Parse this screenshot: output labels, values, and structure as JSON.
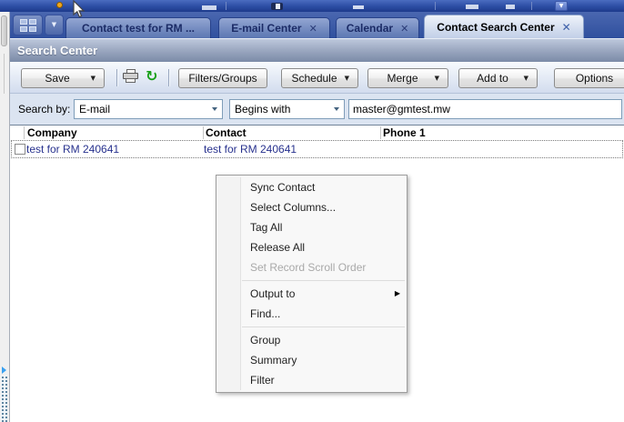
{
  "chrome": {
    "tabs": [
      {
        "label": "Contact test for RM ...",
        "active": false,
        "closable": false
      },
      {
        "label": "E-mail Center",
        "active": false,
        "closable": true
      },
      {
        "label": "Calendar",
        "active": false,
        "closable": true
      },
      {
        "label": "Contact Search Center",
        "active": true,
        "closable": true
      }
    ],
    "close_glyph": "✕",
    "tab_list_dropdown_glyph": "▼",
    "overflow_chevron_glyph": "▼"
  },
  "panel": {
    "title": "Search Center"
  },
  "toolbar": {
    "save": "Save",
    "filters_groups": "Filters/Groups",
    "schedule": "Schedule",
    "merge": "Merge",
    "add_to": "Add to",
    "options": "Options",
    "dropdown_glyph": "▼",
    "refresh_glyph": "↻",
    "icons": {
      "print": "printer-shape",
      "refresh": "green-circular-arrow"
    }
  },
  "search_bar": {
    "label": "Search by:",
    "field": "E-mail",
    "operator": "Begins with",
    "value": "master@gmtest.mw"
  },
  "results": {
    "columns": [
      "Company",
      "Contact",
      "Phone 1"
    ],
    "rows": [
      {
        "company": "test for RM 240641",
        "contact": "test for RM 240641",
        "phone": ""
      }
    ]
  },
  "context_menu": {
    "submenu_glyph": "▶",
    "items": [
      {
        "label": "Sync Contact",
        "disabled": false
      },
      {
        "label": "Select Columns...",
        "disabled": false
      },
      {
        "label": "Tag All",
        "disabled": false
      },
      {
        "label": "Release All",
        "disabled": false
      },
      {
        "label": "Set Record Scroll Order",
        "disabled": true
      },
      {
        "label": "Output to",
        "disabled": false,
        "has_submenu": true
      },
      {
        "label": "Find...",
        "disabled": false
      },
      {
        "label": "Group",
        "disabled": false
      },
      {
        "label": "Summary",
        "disabled": false
      },
      {
        "label": "Filter",
        "disabled": false
      }
    ]
  },
  "colors": {
    "tab_bar_blue": "#32509c",
    "active_tab_bg": "#d7e0f0",
    "panel_header_slate": "#8694b0",
    "row_link_text": "#28328e",
    "refresh_green": "#18a018",
    "notification_orange": "#f0a61e",
    "splitter_blue": "#3aa0f0"
  }
}
